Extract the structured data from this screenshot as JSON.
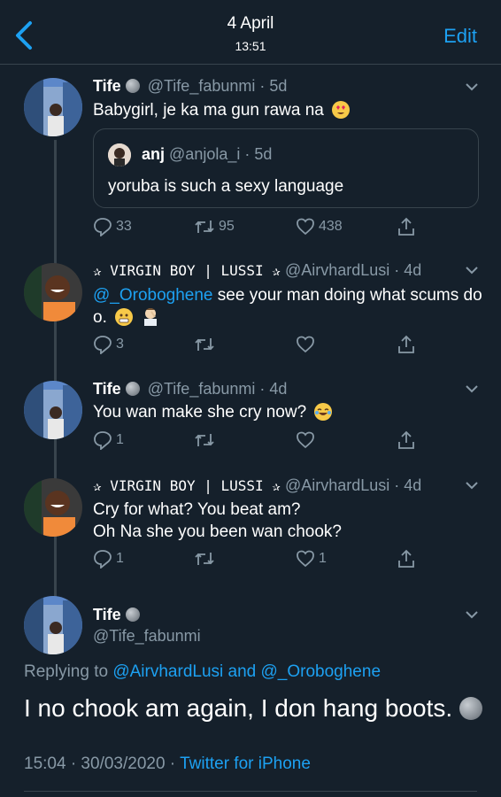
{
  "header": {
    "date": "4 April",
    "time": "13:51",
    "edit_label": "Edit"
  },
  "tweets": [
    {
      "name": "Tife",
      "handle": "@Tife_fabunmi",
      "age": "· 5d",
      "text": "Babygirl, je ka ma gun rawa na",
      "quote": {
        "name": "anj",
        "handle": "@anjola_i",
        "age": "· 5d",
        "text": "yoruba is such a sexy language"
      },
      "replies": "33",
      "retweets": "95",
      "likes": "438"
    },
    {
      "name": "✰ VIRGIN BOY | LUSSI ✰",
      "handle": "@AirvhardLusi",
      "age": "· 4d",
      "mention": "@_Oroboghene",
      "text": " see your man doing what scums do o.",
      "replies": "3",
      "retweets": "",
      "likes": ""
    },
    {
      "name": "Tife",
      "handle": "@Tife_fabunmi",
      "age": "· 4d",
      "text": "You wan make she cry now?",
      "replies": "1",
      "retweets": "",
      "likes": ""
    },
    {
      "name": "✰ VIRGIN BOY | LUSSI ✰",
      "handle": "@AirvhardLusi",
      "age": "· 4d",
      "text_line1": "Cry for what? You beat am?",
      "text_line2": "Oh Na she you been wan chook?",
      "replies": "1",
      "retweets": "",
      "likes": "1"
    }
  ],
  "focused": {
    "name": "Tife",
    "handle": "@Tife_fabunmi",
    "replying_prefix": "Replying to",
    "replying_user1": "@AirvhardLusi",
    "replying_and": " and ",
    "replying_user2": "@_Oroboghene",
    "text": "I no chook am again, I don hang boots.",
    "timestamp": "15:04 · 30/03/2020 · ",
    "source": "Twitter for iPhone"
  },
  "colors": {
    "background": "#15202b",
    "accent": "#1da1f2",
    "secondary_text": "#8899a6",
    "divider": "#38444d"
  },
  "icons": [
    "back-chevron-icon",
    "moon-emoji-icon",
    "heart-eyes-emoji-icon",
    "grimace-emoji-icon",
    "facepalm-emoji-icon",
    "joy-emoji-icon",
    "reply-icon",
    "retweet-icon",
    "like-icon",
    "share-icon",
    "chevron-down-icon"
  ]
}
